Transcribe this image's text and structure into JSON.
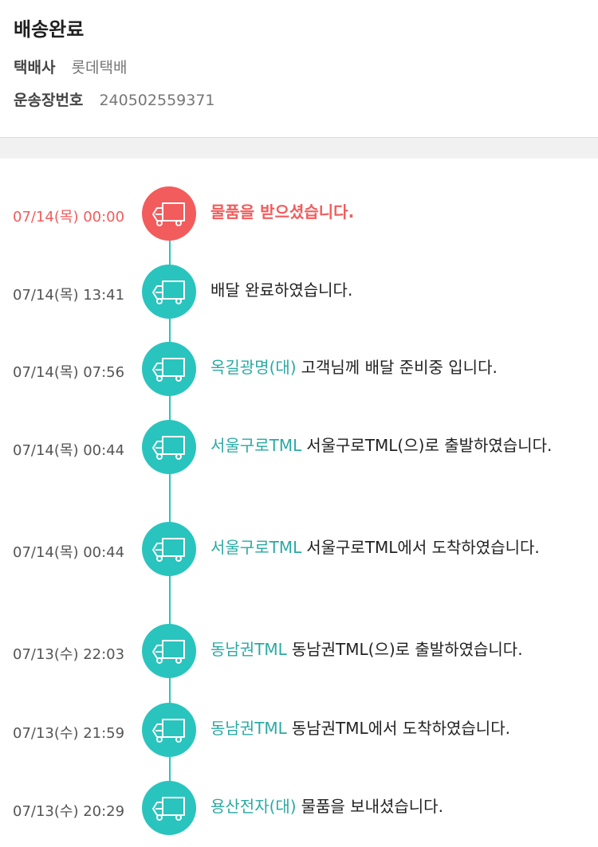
{
  "header": {
    "status_title": "배송완료",
    "courier_label": "택배사",
    "courier_value": "롯데택배",
    "tracking_label": "운송장번호",
    "tracking_value": "240502559371"
  },
  "timeline": {
    "events": [
      {
        "time": "07/14(목) 00:00",
        "location": "",
        "message": "물품을 받으셨습니다.",
        "icon": "truck-icon"
      },
      {
        "time": "07/14(목) 13:41",
        "location": "",
        "message": "배달 완료하였습니다.",
        "icon": "truck-icon"
      },
      {
        "time": "07/14(목) 07:56",
        "location": "옥길광명(대)",
        "message": "고객님께 배달 준비중 입니다.",
        "icon": "truck-icon"
      },
      {
        "time": "07/14(목) 00:44",
        "location": "서울구로TML",
        "message": "서울구로TML(으)로 출발하였습니다.",
        "icon": "truck-icon"
      },
      {
        "time": "07/14(목) 00:44",
        "location": "서울구로TML",
        "message": "서울구로TML에서 도착하였습니다.",
        "icon": "truck-icon"
      },
      {
        "time": "07/13(수) 22:03",
        "location": "동남권TML",
        "message": "동남권TML(으)로 출발하였습니다.",
        "icon": "truck-icon"
      },
      {
        "time": "07/13(수) 21:59",
        "location": "동남권TML",
        "message": "동남권TML에서 도착하였습니다.",
        "icon": "truck-icon"
      },
      {
        "time": "07/13(수) 20:29",
        "location": "용산전자(대)",
        "message": "물품을 보내셨습니다.",
        "icon": "truck-icon"
      }
    ]
  },
  "colors": {
    "accent_teal": "#2ac4be",
    "accent_red": "#f25c5c",
    "location_text": "#2aa9a3"
  }
}
